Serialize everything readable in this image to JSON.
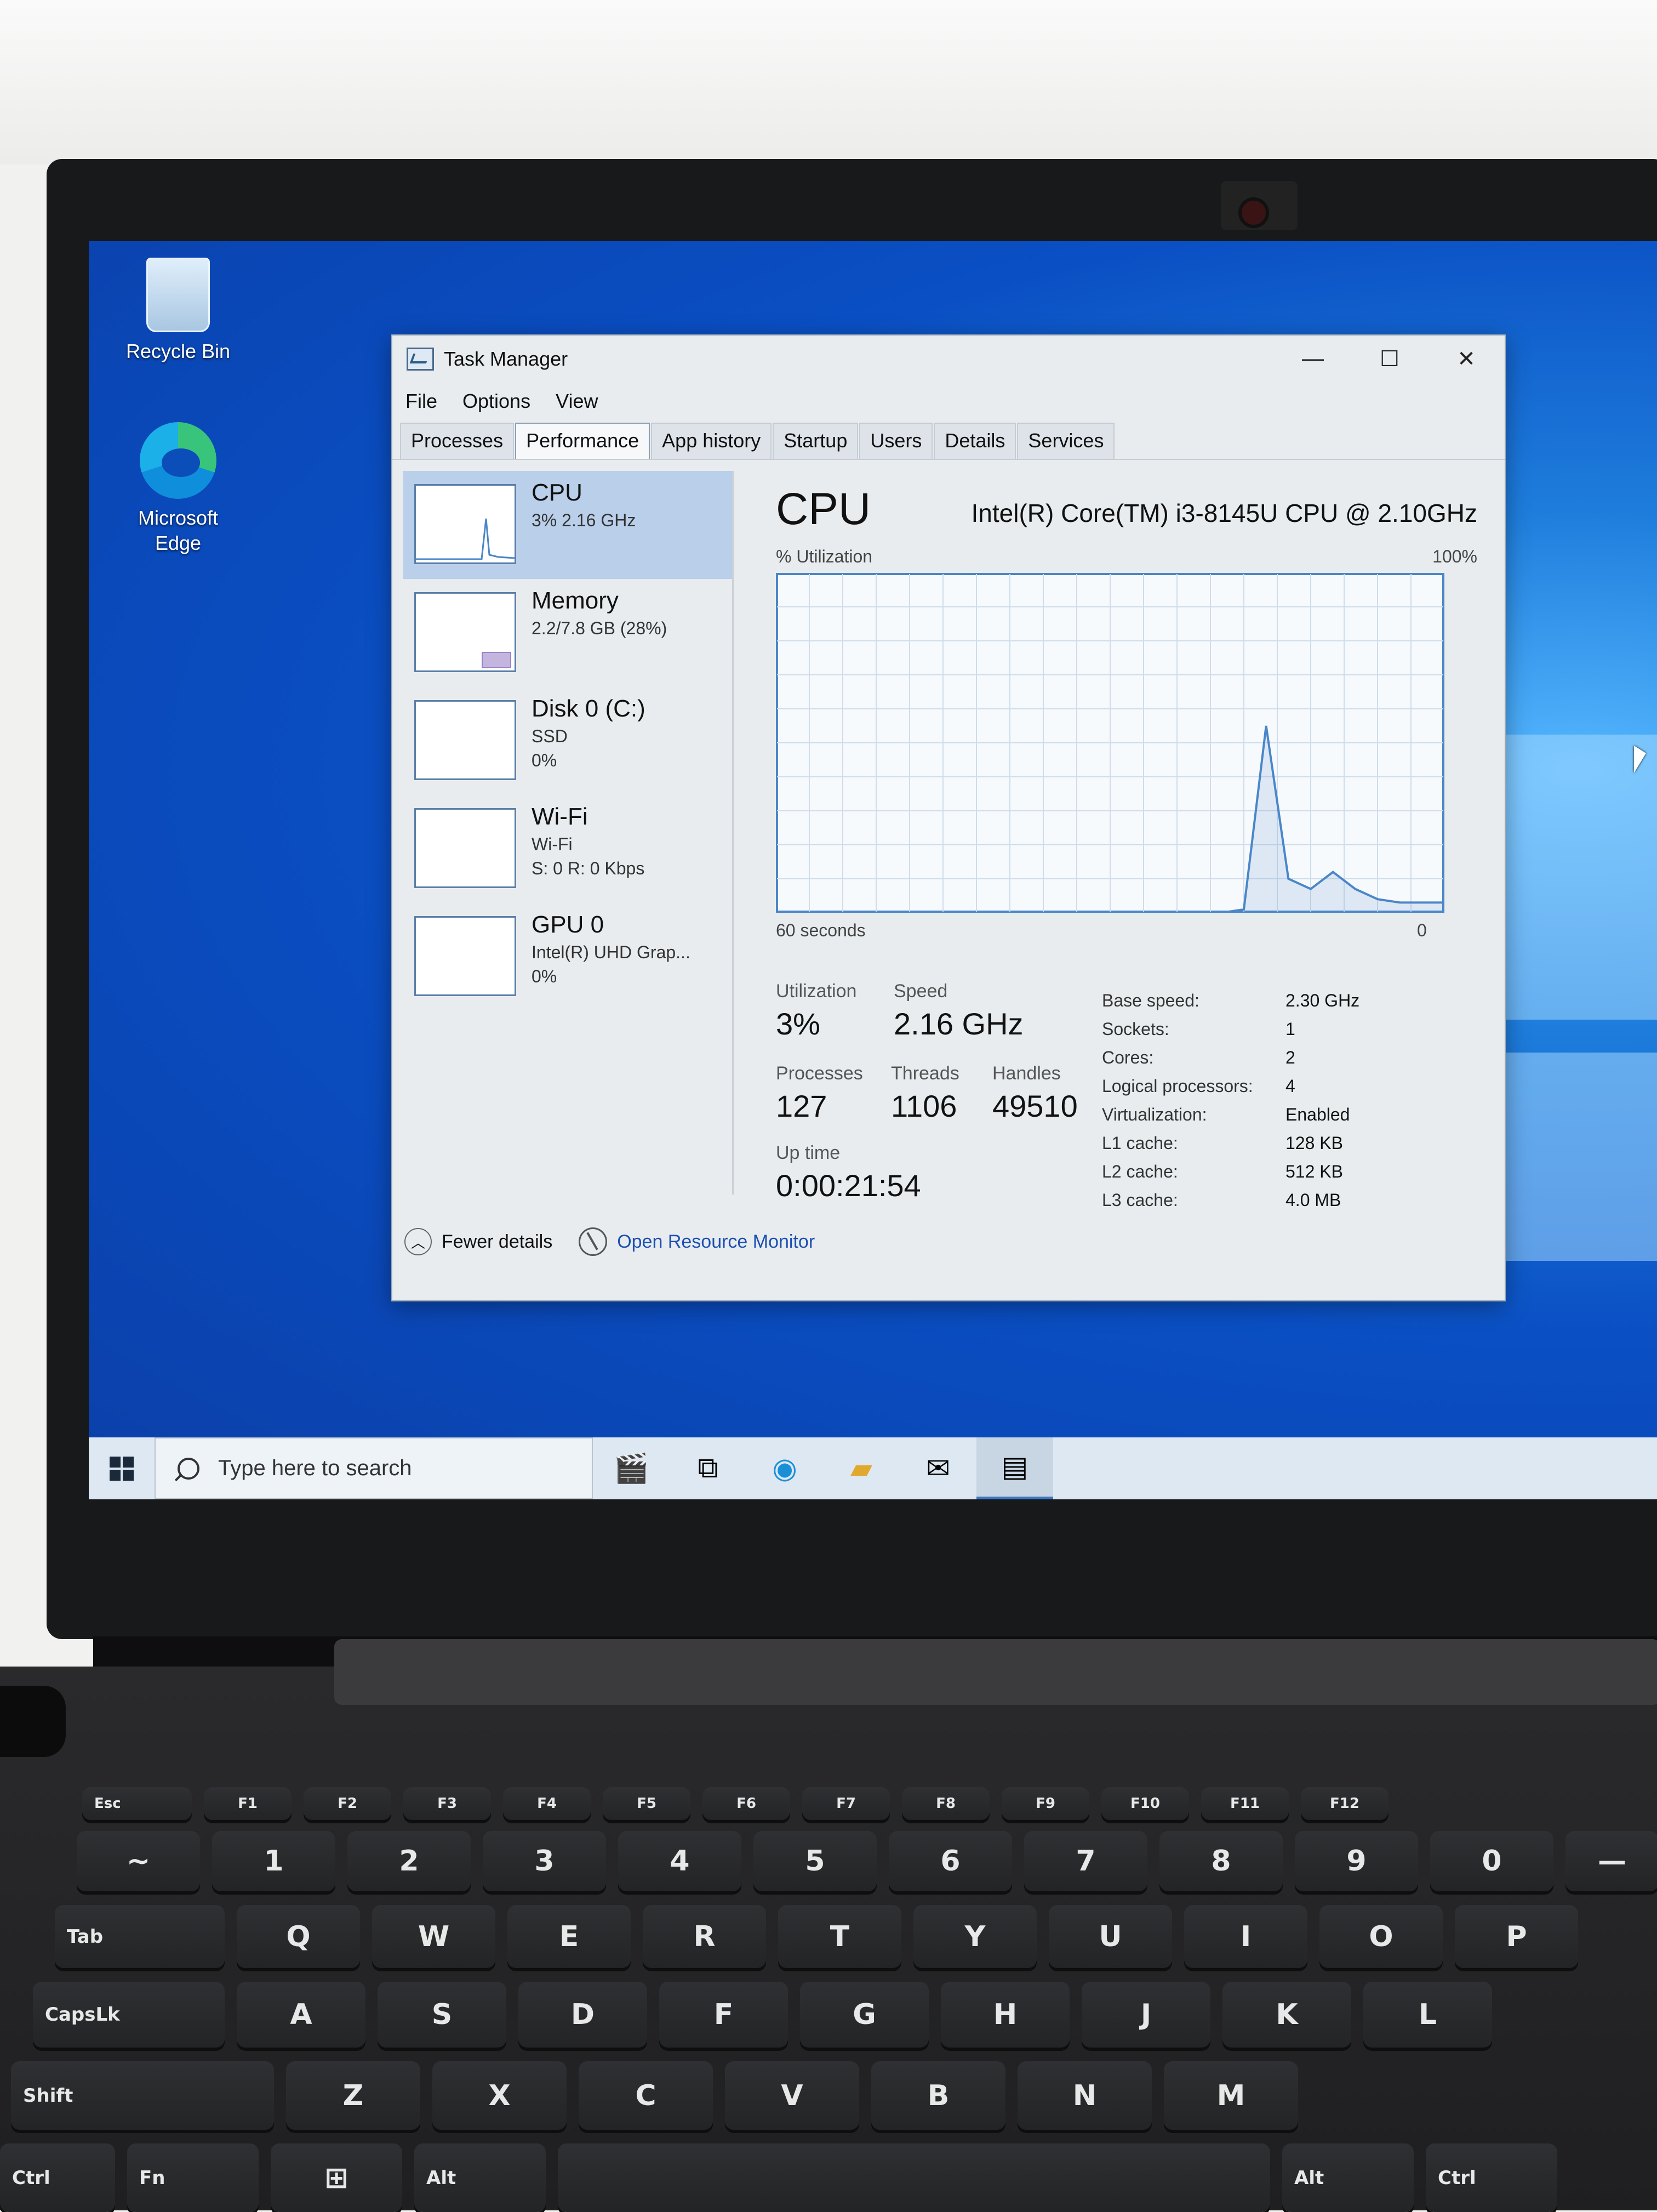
{
  "desktop": {
    "icons": [
      {
        "label": "Recycle Bin",
        "icon": "recycle-bin-icon"
      },
      {
        "label": "Microsoft Edge",
        "icon": "edge-icon"
      }
    ]
  },
  "task_manager": {
    "title": "Task Manager",
    "window_buttons": {
      "minimize": "—",
      "maximize": "☐",
      "close": "✕"
    },
    "menu": [
      "File",
      "Options",
      "View"
    ],
    "tabs": [
      "Processes",
      "Performance",
      "App history",
      "Startup",
      "Users",
      "Details",
      "Services"
    ],
    "active_tab": "Performance",
    "resources": [
      {
        "name": "CPU",
        "sub1": "3% 2.16 GHz",
        "sub2": "",
        "sub3": "",
        "selected": true
      },
      {
        "name": "Memory",
        "sub1": "2.2/7.8 GB (28%)",
        "sub2": "",
        "sub3": ""
      },
      {
        "name": "Disk 0 (C:)",
        "sub1": "SSD",
        "sub2": "0%",
        "sub3": ""
      },
      {
        "name": "Wi-Fi",
        "sub1": "Wi-Fi",
        "sub2": "S: 0 R: 0 Kbps",
        "sub3": ""
      },
      {
        "name": "GPU 0",
        "sub1": "Intel(R) UHD Grap...",
        "sub2": "0%",
        "sub3": ""
      }
    ],
    "detail": {
      "title": "CPU",
      "model": "Intel(R) Core(TM) i3-8145U CPU @ 2.10GHz",
      "util_label": "% Utilization",
      "util_max": "100%",
      "axis_left": "60 seconds",
      "axis_right": "0",
      "stats": {
        "utilization_label": "Utilization",
        "utilization": "3%",
        "speed_label": "Speed",
        "speed": "2.16 GHz",
        "processes_label": "Processes",
        "processes": "127",
        "threads_label": "Threads",
        "threads": "1106",
        "handles_label": "Handles",
        "handles": "49510",
        "uptime_label": "Up time",
        "uptime": "0:00:21:54"
      },
      "specs": [
        {
          "k": "Base speed:",
          "v": "2.30 GHz"
        },
        {
          "k": "Sockets:",
          "v": "1"
        },
        {
          "k": "Cores:",
          "v": "2"
        },
        {
          "k": "Logical processors:",
          "v": "4"
        },
        {
          "k": "Virtualization:",
          "v": "Enabled"
        },
        {
          "k": "L1 cache:",
          "v": "128 KB"
        },
        {
          "k": "L2 cache:",
          "v": "512 KB"
        },
        {
          "k": "L3 cache:",
          "v": "4.0 MB"
        }
      ]
    },
    "footer": {
      "fewer": "Fewer details",
      "monitor": "Open Resource Monitor"
    }
  },
  "chart_data": {
    "type": "line",
    "x": [
      60,
      58,
      56,
      54,
      52,
      50,
      48,
      46,
      44,
      42,
      40,
      38,
      36,
      34,
      32,
      30,
      28,
      26,
      24,
      22,
      20,
      18,
      16,
      14,
      12,
      10,
      8,
      6,
      4,
      2,
      0
    ],
    "series": [
      {
        "values": [
          0,
          0,
          0,
          0,
          0,
          0,
          0,
          0,
          0,
          0,
          0,
          0,
          0,
          0,
          0,
          0,
          0,
          0,
          0,
          0,
          0,
          1,
          55,
          10,
          7,
          12,
          7,
          4,
          3,
          3,
          3
        ]
      }
    ],
    "ylabel": "% Utilization",
    "ylim": [
      0,
      100
    ],
    "xlim": [
      60,
      0
    ],
    "grid": true,
    "color": "#4a86c8"
  },
  "taskbar": {
    "search_placeholder": "Type here to search",
    "icons": [
      "windows-start-icon",
      "news-widget-icon",
      "task-view-icon",
      "edge-icon",
      "file-explorer-icon",
      "mail-icon",
      "task-manager-icon"
    ]
  },
  "keyboard": {
    "row_f": [
      "Esc",
      "F1",
      "F2",
      "F3",
      "F4",
      "F5",
      "F6",
      "F7",
      "F8",
      "F9",
      "F10",
      "F11",
      "F12"
    ],
    "row_num": [
      "~",
      "1",
      "2",
      "3",
      "4",
      "5",
      "6",
      "7",
      "8",
      "9",
      "0",
      "—"
    ],
    "row_q": [
      "Tab",
      "Q",
      "W",
      "E",
      "R",
      "T",
      "Y",
      "U",
      "I",
      "O",
      "P"
    ],
    "row_a": [
      "CapsLk",
      "A",
      "S",
      "D",
      "F",
      "G",
      "H",
      "J",
      "K",
      "L"
    ],
    "row_z": [
      "Shift",
      "Z",
      "X",
      "C",
      "V",
      "B",
      "N",
      "M"
    ],
    "row_b": [
      "Ctrl",
      "Fn",
      "",
      "Alt",
      "",
      "Alt",
      "Ctrl"
    ]
  }
}
